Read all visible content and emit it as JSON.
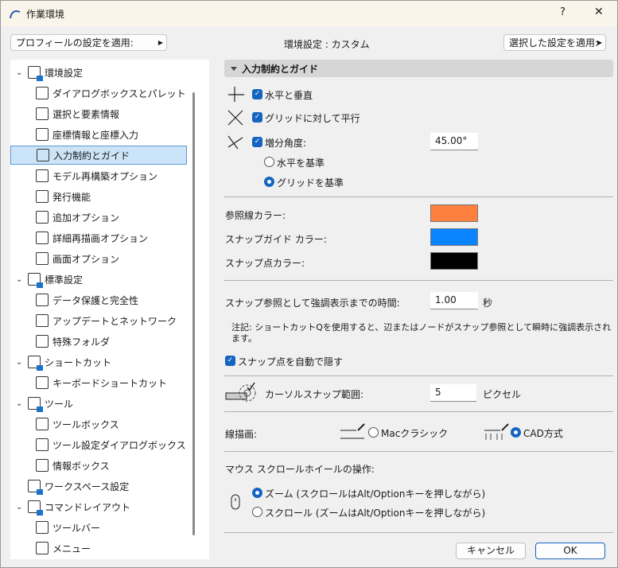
{
  "window": {
    "title": "作業環境",
    "help": "?",
    "close": "✕"
  },
  "top": {
    "profile_label": "プロフィールの設定を適用:",
    "status": "環境設定 : カスタム",
    "apply_selected": "選択した設定を適用:"
  },
  "tree": [
    {
      "level": 0,
      "label": "環境設定"
    },
    {
      "level": 1,
      "label": "ダイアログボックスとパレット"
    },
    {
      "level": 1,
      "label": "選択と要素情報"
    },
    {
      "level": 1,
      "label": "座標情報と座標入力"
    },
    {
      "level": 1,
      "label": "入力制約とガイド",
      "selected": true
    },
    {
      "level": 1,
      "label": "モデル再構築オプション"
    },
    {
      "level": 1,
      "label": "発行機能"
    },
    {
      "level": 1,
      "label": "追加オプション"
    },
    {
      "level": 1,
      "label": "詳細再描画オプション"
    },
    {
      "level": 1,
      "label": "画面オプション"
    },
    {
      "level": 0,
      "label": "標準設定"
    },
    {
      "level": 1,
      "label": "データ保護と完全性"
    },
    {
      "level": 1,
      "label": "アップデートとネットワーク"
    },
    {
      "level": 1,
      "label": "特殊フォルダ"
    },
    {
      "level": 0,
      "label": "ショートカット"
    },
    {
      "level": 1,
      "label": "キーボードショートカット"
    },
    {
      "level": 0,
      "label": "ツール"
    },
    {
      "level": 1,
      "label": "ツールボックス"
    },
    {
      "level": 1,
      "label": "ツール設定ダイアログボックス"
    },
    {
      "level": 1,
      "label": "情報ボックス"
    },
    {
      "level": 0,
      "label": "ワークスペース設定",
      "nochev": true
    },
    {
      "level": 0,
      "label": "コマンドレイアウト"
    },
    {
      "level": 1,
      "label": "ツールバー"
    },
    {
      "level": 1,
      "label": "メニュー"
    }
  ],
  "section": {
    "title": "入力制約とガイド"
  },
  "constraints": {
    "horiz_vert": "水平と垂直",
    "grid_parallel": "グリッドに対して平行",
    "increment_angle": "増分角度:",
    "angle_value": "45.00°",
    "radio_horizontal": "水平を基準",
    "radio_grid": "グリッドを基準"
  },
  "colors": {
    "ref_line_label": "参照線カラー:",
    "ref_line": "#ff7f3f",
    "snap_guide_label": "スナップガイド カラー:",
    "snap_guide": "#0a84ff",
    "snap_point_label": "スナップ点カラー:",
    "snap_point": "#000000"
  },
  "timing": {
    "label": "スナップ参照として強調表示までの時間:",
    "value": "1.00",
    "unit": "秒",
    "note": "注記: ショートカットQを使用すると、辺またはノードがスナップ参照として瞬時に強調表示されます。"
  },
  "auto_hide": "スナップ点を自動で隠す",
  "cursor_snap": {
    "label": "カーソルスナップ範囲:",
    "value": "5",
    "unit": "ピクセル"
  },
  "line_draw": {
    "label": "線描画:",
    "mac": "Macクラシック",
    "cad": "CAD方式"
  },
  "mouse": {
    "label": "マウス スクロールホイールの操作:",
    "zoom": "ズーム (スクロールはAlt/Optionキーを押しながら)",
    "scroll": "スクロール (ズームはAlt/Optionキーを押しながら)"
  },
  "buttons": {
    "cancel": "キャンセル",
    "ok": "OK"
  }
}
